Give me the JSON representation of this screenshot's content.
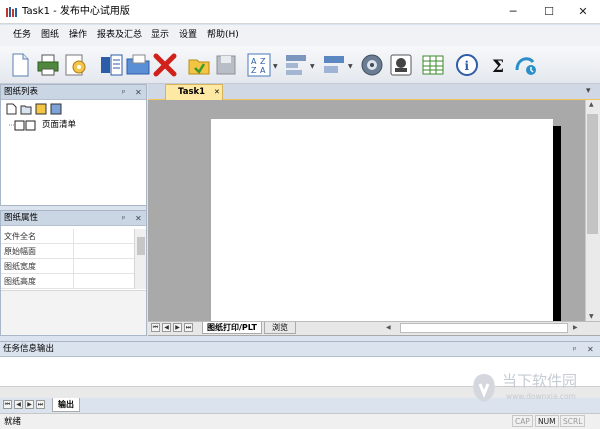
{
  "window": {
    "title": "Task1 - 发布中心试用版",
    "minimize_glyph": "─",
    "maximize_glyph": "☐",
    "close_glyph": "✕"
  },
  "menu": {
    "items": [
      "任务",
      "图纸",
      "操作",
      "报表及汇总",
      "显示",
      "设置",
      "帮助(H)"
    ]
  },
  "toolbar": {
    "icons": [
      "new-icon",
      "printer-icon",
      "settings-page-icon",
      "import-icon",
      "open-folder-icon",
      "delete-icon",
      "refresh-icon",
      "save-icon",
      "sort-icon",
      "layout-icon",
      "align-icon",
      "gear-icon",
      "stamp-icon",
      "table-icon",
      "info-icon",
      "sum-icon",
      "query-icon"
    ]
  },
  "drawing_list": {
    "title": "图纸列表",
    "pin": "ᵖ",
    "close": "✕",
    "tree_item": "页面清单"
  },
  "drawing_props": {
    "title": "图纸属性",
    "pin": "ᵖ",
    "close": "✕",
    "rows": [
      "文件全名",
      "原始幅面",
      "图纸宽度",
      "图纸高度"
    ]
  },
  "document": {
    "tab_label": "Task1",
    "tab_close": "✕",
    "dropdown": "▾",
    "bottom_tabs": [
      "图纸打印/PLT",
      "浏览"
    ]
  },
  "output_panel": {
    "title": "任务信息输出",
    "pin": "ᵖ",
    "close": "✕",
    "tab_label": "输出"
  },
  "status": {
    "text": "就绪",
    "keys": [
      "CAP",
      "NUM",
      "SCRL"
    ]
  },
  "watermark": {
    "text": "当下软件园",
    "url": "www.downxia.com"
  },
  "colors": {
    "accent_tab": "#fde9a4",
    "panel_header": "#cbd6e4",
    "doc_background": "#a9a9a9"
  }
}
